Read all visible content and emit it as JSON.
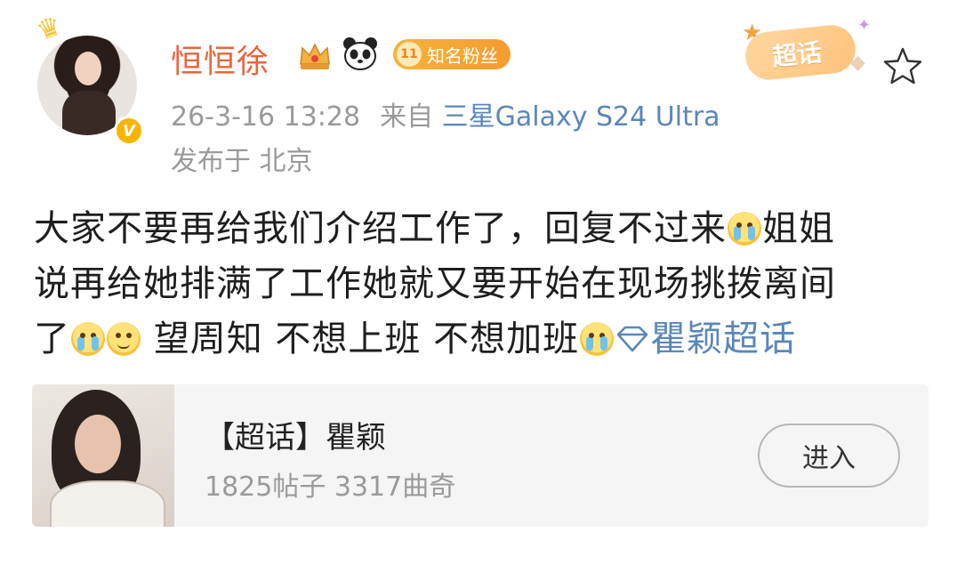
{
  "post": {
    "username": "恒恒徐",
    "fan_level": "11",
    "fan_badge_label": "知名粉丝",
    "timestamp": "26-3-16 13:28",
    "source_prefix": "来自",
    "device": "三星Galaxy S24 Ultra",
    "location": "发布于 北京",
    "chaohua_tag": "超话",
    "content": {
      "line1_text": "大家不要再给我们介绍工作了，回复不过来",
      "line1_tail": "姐姐",
      "line2": "说再给她排满了工作她就又要开始在现场挑拨离间",
      "line3_start": "了",
      "line3_mid": " 望周知 不想上班 不想加班",
      "topic": "瞿颖超话"
    }
  },
  "card": {
    "title": "【超话】瞿颖",
    "stats": "1825帖子 3317曲奇",
    "enter_label": "进入"
  },
  "icons": {
    "verified": "verified-v-icon",
    "crown": "crown-icon",
    "panda": "panda-icon",
    "star": "star-outline-icon",
    "diamond": "diamond-icon",
    "cry_emoji": "crying-face-emoji",
    "smile_emoji": "smile-face-emoji"
  },
  "colors": {
    "username": "#e8663b",
    "link": "#5b87b8",
    "meta": "#9a9a9a",
    "badge": "#f7b33a"
  }
}
